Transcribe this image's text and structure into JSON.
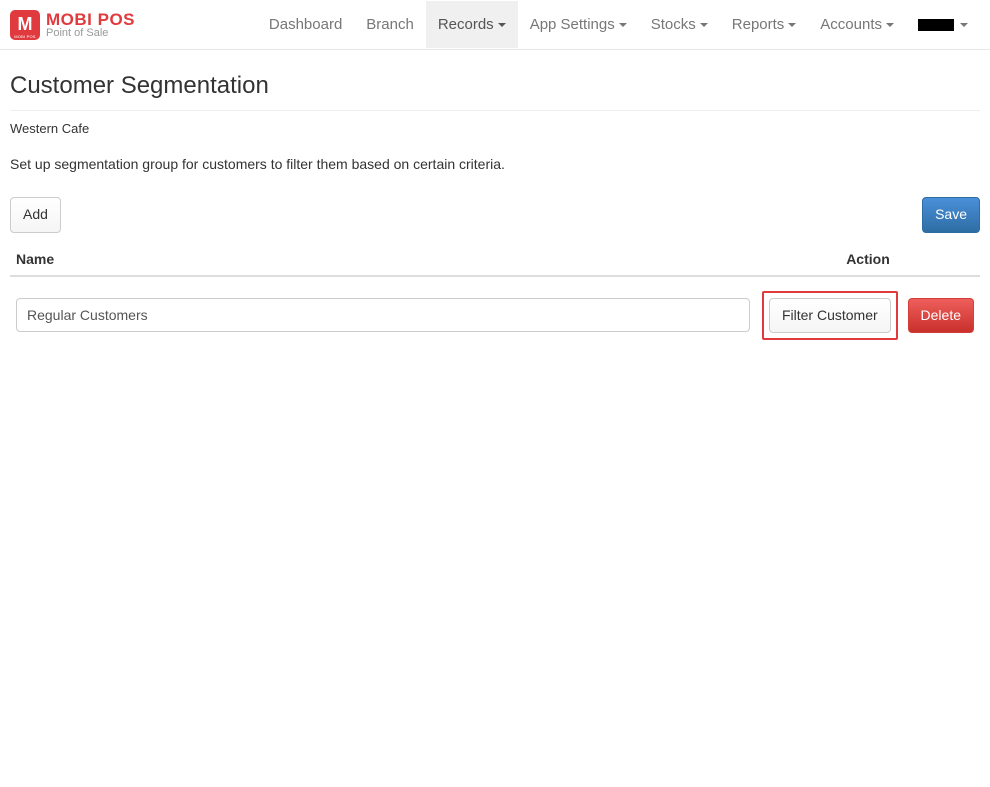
{
  "brand": {
    "logo_letter": "M",
    "name": "MOBI POS",
    "tagline": "Point of Sale"
  },
  "nav": {
    "dashboard": "Dashboard",
    "branch": "Branch",
    "records": "Records",
    "app_settings": "App Settings",
    "stocks": "Stocks",
    "reports": "Reports",
    "accounts": "Accounts"
  },
  "page": {
    "title": "Customer Segmentation",
    "branch_name": "Western Cafe",
    "description": "Set up segmentation group for customers to filter them based on certain criteria."
  },
  "buttons": {
    "add": "Add",
    "save": "Save",
    "filter_customer": "Filter Customer",
    "delete": "Delete"
  },
  "table": {
    "col_name": "Name",
    "col_action": "Action",
    "rows": [
      {
        "name": "Regular Customers"
      }
    ]
  }
}
